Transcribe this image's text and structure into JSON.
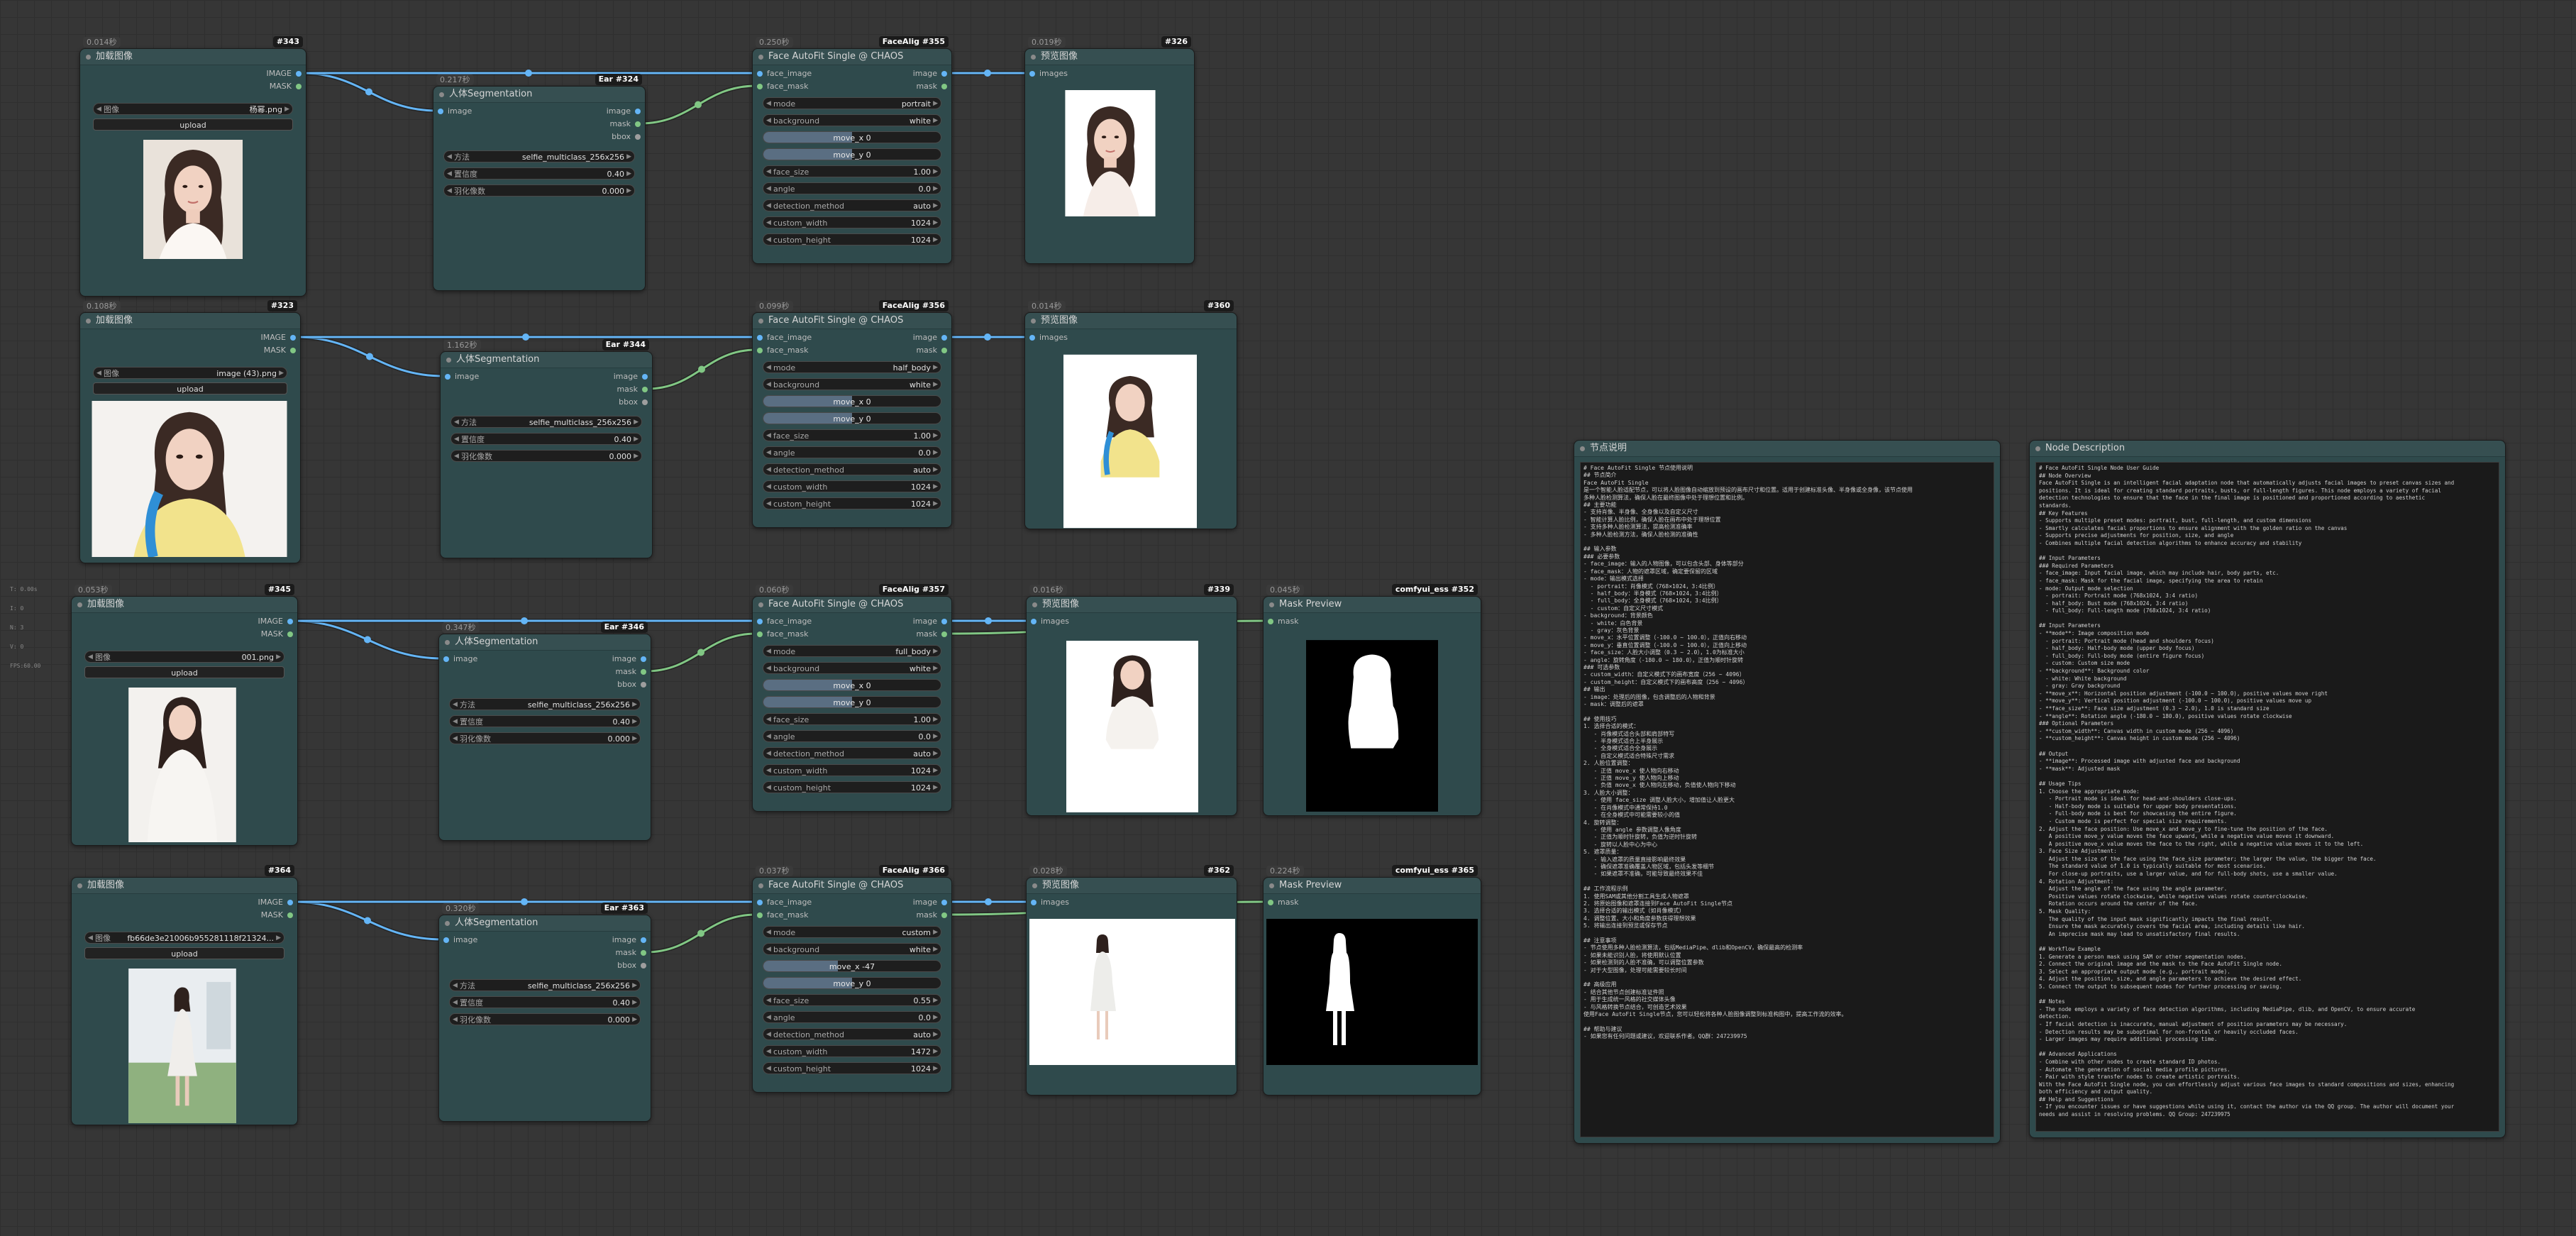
{
  "colors": {
    "image_wire": "#64b5f6",
    "mask_wire": "#81c784",
    "node_bg": "#2f4a4c",
    "canvas": "#363636"
  },
  "stats": [
    "T: 0.00s",
    "I: 0",
    "N: 3",
    "V: 0",
    "FPS:60.00"
  ],
  "rows": [
    {
      "load": {
        "timing": "0.014秒",
        "badge": "#343",
        "title": "加载图像",
        "outputs": [
          "IMAGE",
          "MASK"
        ],
        "image_label": "图像",
        "image_value": "杨幂.png",
        "upload": "upload"
      },
      "seg": {
        "timing": "0.217秒",
        "badge": "Ear #324",
        "title": "人体Segmentation",
        "input": "image",
        "outputs": [
          "image",
          "mask",
          "bbox"
        ],
        "widgets": [
          {
            "label": "方法",
            "value": "selfie_multiclass_256x256"
          },
          {
            "label": "置信度",
            "value": "0.40"
          },
          {
            "label": "羽化像数",
            "value": "0.000"
          }
        ]
      },
      "face": {
        "timing": "0.250秒",
        "badge": "FaceAlig #355",
        "title": "Face AutoFit Single @ CHAOS",
        "inputs": [
          "face_image",
          "face_mask"
        ],
        "outputs": [
          "image",
          "mask"
        ],
        "mode": "portrait",
        "background": "white",
        "move_x": "move_x 0",
        "move_y": "move_y 0",
        "face_size": "1.00",
        "angle": "0.0",
        "detection_method": "auto",
        "custom_width": "1024",
        "custom_height": "1024"
      },
      "preview": {
        "timing": "0.019秒",
        "badge": "#326",
        "title": "预览图像",
        "input": "images"
      }
    },
    {
      "load": {
        "timing": "0.108秒",
        "badge": "#323",
        "title": "加载图像",
        "outputs": [
          "IMAGE",
          "MASK"
        ],
        "image_label": "图像",
        "image_value": "image (43).png",
        "upload": "upload"
      },
      "seg": {
        "timing": "1.162秒",
        "badge": "Ear #344",
        "title": "人体Segmentation",
        "input": "image",
        "outputs": [
          "image",
          "mask",
          "bbox"
        ],
        "widgets": [
          {
            "label": "方法",
            "value": "selfie_multiclass_256x256"
          },
          {
            "label": "置信度",
            "value": "0.40"
          },
          {
            "label": "羽化像数",
            "value": "0.000"
          }
        ]
      },
      "face": {
        "timing": "0.099秒",
        "badge": "FaceAlig #356",
        "title": "Face AutoFit Single @ CHAOS",
        "inputs": [
          "face_image",
          "face_mask"
        ],
        "outputs": [
          "image",
          "mask"
        ],
        "mode": "half_body",
        "background": "white",
        "move_x": "move_x 0",
        "move_y": "move_y 0",
        "face_size": "1.00",
        "angle": "0.0",
        "detection_method": "auto",
        "custom_width": "1024",
        "custom_height": "1024"
      },
      "preview": {
        "timing": "0.014秒",
        "badge": "#360",
        "title": "预览图像",
        "input": "images"
      }
    },
    {
      "load": {
        "timing": "0.053秒",
        "badge": "#345",
        "title": "加载图像",
        "outputs": [
          "IMAGE",
          "MASK"
        ],
        "image_label": "图像",
        "image_value": "001.png",
        "upload": "upload"
      },
      "seg": {
        "timing": "0.347秒",
        "badge": "Ear #346",
        "title": "人体Segmentation",
        "input": "image",
        "outputs": [
          "image",
          "mask",
          "bbox"
        ],
        "widgets": [
          {
            "label": "方法",
            "value": "selfie_multiclass_256x256"
          },
          {
            "label": "置信度",
            "value": "0.40"
          },
          {
            "label": "羽化像数",
            "value": "0.000"
          }
        ]
      },
      "face": {
        "timing": "0.060秒",
        "badge": "FaceAlig #357",
        "title": "Face AutoFit Single @ CHAOS",
        "inputs": [
          "face_image",
          "face_mask"
        ],
        "outputs": [
          "image",
          "mask"
        ],
        "mode": "full_body",
        "background": "white",
        "move_x": "move_x 0",
        "move_y": "move_y 0",
        "face_size": "1.00",
        "angle": "0.0",
        "detection_method": "auto",
        "custom_width": "1024",
        "custom_height": "1024"
      },
      "preview": {
        "timing": "0.016秒",
        "badge": "#339",
        "title": "预览图像",
        "input": "images"
      },
      "mask_preview": {
        "timing": "0.045秒",
        "badge": "comfyui_ess #352",
        "title": "Mask Preview",
        "input": "mask"
      }
    },
    {
      "load": {
        "timing": "",
        "badge": "#364",
        "title": "加载图像",
        "outputs": [
          "IMAGE",
          "MASK"
        ],
        "image_label": "图像",
        "image_value": "fb66de3e21006b955281118f21324...",
        "upload": "upload"
      },
      "seg": {
        "timing": "0.320秒",
        "badge": "Ear #363",
        "title": "人体Segmentation",
        "input": "image",
        "outputs": [
          "image",
          "mask",
          "bbox"
        ],
        "widgets": [
          {
            "label": "方法",
            "value": "selfie_multiclass_256x256"
          },
          {
            "label": "置信度",
            "value": "0.40"
          },
          {
            "label": "羽化像数",
            "value": "0.000"
          }
        ]
      },
      "face": {
        "timing": "0.037秒",
        "badge": "FaceAlig #366",
        "title": "Face AutoFit Single @ CHAOS",
        "inputs": [
          "face_image",
          "face_mask"
        ],
        "outputs": [
          "image",
          "mask"
        ],
        "mode": "custom",
        "background": "white",
        "move_x": "move_x -47",
        "move_y": "move_y 0",
        "face_size": "0.55",
        "angle": "0.0",
        "detection_method": "auto",
        "custom_width": "1472",
        "custom_height": "1024"
      },
      "preview": {
        "timing": "0.028秒",
        "badge": "#362",
        "title": "预览图像",
        "input": "images"
      },
      "mask_preview": {
        "timing": "0.224秒",
        "badge": "comfyui_ess #365",
        "title": "Mask Preview",
        "input": "mask"
      }
    }
  ],
  "widget_labels": {
    "mode": "mode",
    "background": "background",
    "face_size": "face_size",
    "angle": "angle",
    "detection_method": "detection_method",
    "custom_width": "custom_width",
    "custom_height": "custom_height"
  },
  "notes_cn": {
    "title": "节点说明",
    "text": "# Face AutoFit Single 节点使用说明\n## 节点简介\nFace AutoFit Single\n是一个智能人脸适配节点，可以将人脸图像自动缩放到预设的画布尺寸和位置。适用于创建标准头像、半身像或全身像，该节点使用\n多种人脸检测算法，确保人脸在最终图像中处于理想位置和比例。\n## 主要功能\n- 支持肖像、半身像、全身像以及自定义尺寸\n- 智能计算人脸比例，确保人脸在画布中处于理想位置\n- 支持多种人脸检测算法，提高检测准确率\n- 多种人脸检测方法，确保人脸检测的准确性\n\n## 输入参数\n### 必要参数\n- face_image：输入的人物图像，可以包含头部、身体等部分\n- face_mask：人物的遮罩区域，确定要保留的区域\n- mode：输出模式选择\n  - portrait：肖像模式（768×1024，3:4比例）\n  - half_body：半身模式（768×1024，3:4比例）\n  - full_body：全身模式（768×1024，3:4比例）\n  - custom：自定义尺寸模式\n- background：背景颜色\n  - white：白色背景\n  - gray：灰色背景\n- move_x：水平位置调整（-100.0 ~ 100.0），正值向右移动\n- move_y：垂直位置调整（-100.0 ~ 100.0），正值向上移动\n- face_size：人脸大小调整（0.3 ~ 2.0），1.0为标准大小\n- angle：旋转角度（-180.0 ~ 180.0），正值为顺时针旋转\n### 可选参数\n- custom_width：自定义模式下的画布宽度（256 ~ 4096）\n- custom_height：自定义模式下的画布高度（256 ~ 4096）\n## 输出\n- image：处理后的图像，包含调整后的人物和背景\n- mask：调整后的遮罩\n\n## 使用技巧\n1. 选择合适的模式：\n   - 肖像模式适合头部和肩部特写\n   - 半身模式适合上半身展示\n   - 全身模式适合全身展示\n   - 自定义模式适合特殊尺寸需求\n2. 人脸位置调整：\n   - 正值 move_x 使人物向右移动\n   - 正值 move_y 使人物向上移动\n   - 负值 move_x 使人物向左移动，负值使人物向下移动\n3. 人脸大小调整：\n   - 使用 face_size 调整人脸大小，增加值让人脸更大\n   - 在肖像模式中通常保持1.0\n   - 在全身模式中可能需要较小的值\n4. 旋转调整：\n   - 使用 angle 参数调整人像角度\n   - 正值为顺时针旋转，负值为逆时针旋转\n   - 旋转以人脸中心为中心\n5. 遮罩质量：\n   - 输入遮罩的质量直接影响最终效果\n   - 确保遮罩准确覆盖人物区域，包括头发等细节\n   - 如果遮罩不准确，可能导致最终效果不佳\n\n## 工作流程示例\n1. 使用SAM或其他分割工具生成人物遮罩\n2. 将原始图像和遮罩连接到Face AutoFit Single节点\n3. 选择合适的输出模式（如肖像模式）\n4. 调整位置、大小和角度参数获得理想效果\n5. 将输出连接到预览或保存节点\n\n## 注意事项\n- 节点使用多种人脸检测算法，包括MediaPipe、dlib和OpenCV，确保最高的检测率\n- 如果未能识别人脸，将使用默认位置\n- 如果检测到的人脸不准确，可以调整位置参数\n- 对于大型图像，处理可能需要较长时间\n\n## 高级应用\n- 结合其他节点创建标准证件照\n- 用于生成统一风格的社交媒体头像\n- 与风格转换节点结合，可创造艺术效果\n使用Face AutoFit Single节点，您可以轻松将各种人脸图像调整到标准构图中，提高工作流的效率。\n\n## 帮助与建议\n- 如果您有任何问题或建议，欢迎联系作者。QQ群：247239975"
  },
  "notes_en": {
    "title": "Node Description",
    "text": "# Face AutoFit Single Node User Guide\n## Node Overview\nFace AutoFit Single is an intelligent facial adaptation node that automatically adjusts facial images to preset canvas sizes and\npositions. It is ideal for creating standard portraits, busts, or full-length figures. This node employs a variety of facial\ndetection technologies to ensure that the face in the final image is positioned and proportioned according to aesthetic\nstandards.\n## Key Features\n- Supports multiple preset modes: portrait, bust, full-length, and custom dimensions\n- Smartly calculates facial proportions to ensure alignment with the golden ratio on the canvas\n- Supports precise adjustments for position, size, and angle\n- Combines multiple facial detection algorithms to enhance accuracy and stability\n\n## Input Parameters\n### Required Parameters\n- face_image: Input facial image, which may include hair, body parts, etc.\n- face_mask: Mask for the facial image, specifying the area to retain\n- mode: Output mode selection\n  - portrait: Portrait mode (768x1024, 3:4 ratio)\n  - half_body: Bust mode (768x1024, 3:4 ratio)\n  - full_body: Full-length mode (768x1024, 3:4 ratio)\n\n## Input Parameters\n- **mode**: Image composition mode\n  - portrait: Portrait mode (head and shoulders focus)\n  - half_body: Half-body mode (upper body focus)\n  - full_body: Full-body mode (entire figure focus)\n  - custom: Custom size mode\n- **background**: Background color\n  - white: White background\n  - gray: Gray background\n- **move_x**: Horizontal position adjustment (-100.0 ~ 100.0), positive values move right\n- **move_y**: Vertical position adjustment (-100.0 ~ 100.0), positive values move up\n- **face_size**: Face size adjustment (0.3 ~ 2.0), 1.0 is standard size\n- **angle**: Rotation angle (-180.0 ~ 180.0), positive values rotate clockwise\n### Optional Parameters\n- **custom_width**: Canvas width in custom mode (256 ~ 4096)\n- **custom_height**: Canvas height in custom mode (256 ~ 4096)\n\n## Output\n- **image**: Processed image with adjusted face and background\n- **mask**: Adjusted mask\n\n## Usage Tips\n1. Choose the appropriate mode:\n   - Portrait mode is ideal for head-and-shoulders close-ups.\n   - Half-body mode is suitable for upper body presentations.\n   - Full-body mode is best for showcasing the entire figure.\n   - Custom mode is perfect for special size requirements.\n2. Adjust the face position: Use move_x and move_y to fine-tune the position of the face.\n   A positive move_y value moves the face upward, while a negative value moves it downward.\n   A positive move_x value moves the face to the right, while a negative value moves it to the left.\n3. Face Size Adjustment:\n   Adjust the size of the face using the face_size parameter; the larger the value, the bigger the face.\n   The standard value of 1.0 is typically suitable for most scenarios.\n   For close-up portraits, use a larger value, and for full-body shots, use a smaller value.\n4. Rotation Adjustment:\n   Adjust the angle of the face using the angle parameter.\n   Positive values rotate clockwise, while negative values rotate counterclockwise.\n   Rotation occurs around the center of the face.\n5. Mask Quality:\n   The quality of the input mask significantly impacts the final result.\n   Ensure the mask accurately covers the facial area, including details like hair.\n   An imprecise mask may lead to unsatisfactory final results.\n\n## Workflow Example\n1. Generate a person mask using SAM or other segmentation nodes.\n2. Connect the original image and the mask to the Face AutoFit Single node.\n3. Select an appropriate output mode (e.g., portrait mode).\n4. Adjust the position, size, and angle parameters to achieve the desired effect.\n5. Connect the output to subsequent nodes for further processing or saving.\n\n## Notes\n- The node employs a variety of face detection algorithms, including MediaPipe, dlib, and OpenCV, to ensure accurate\ndetection.\n- If facial detection is inaccurate, manual adjustment of position parameters may be necessary.\n- Detection results may be suboptimal for non-frontal or heavily occluded faces.\n- Larger images may require additional processing time.\n\n## Advanced Applications\n- Combine with other nodes to create standard ID photos.\n- Automate the generation of social media profile pictures.\n- Pair with style transfer nodes to create artistic portraits.\nWith the Face AutoFit Single node, you can effortlessly adjust various face images to standard compositions and sizes, enhancing\nboth efficiency and output quality.\n## Help and Suggestions\n- If you encounter issues or have suggestions while using it, contact the author via the QQ group. The author will document your\nneeds and assist in resolving problems. QQ Group: 247239975"
  }
}
